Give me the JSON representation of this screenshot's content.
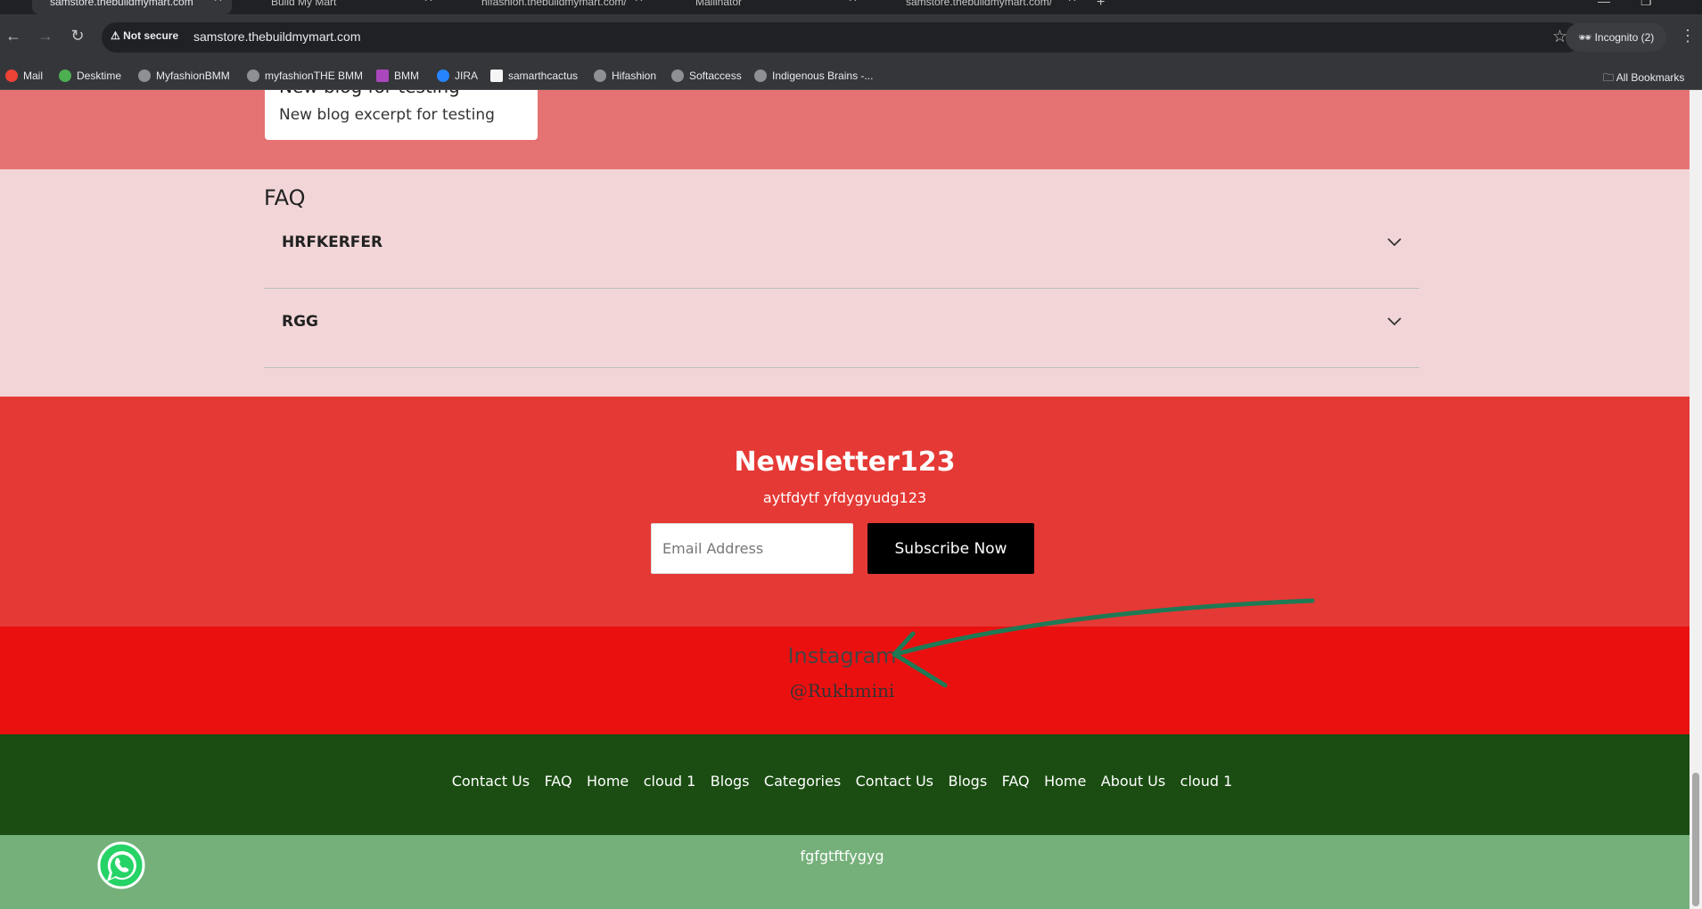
{
  "browser": {
    "tabs": [
      {
        "label": "samstore.thebuildmymart.com",
        "active": true
      },
      {
        "label": "Build My Mart",
        "active": false
      },
      {
        "label": "hifashion.thebuildmymart.com/",
        "active": false
      },
      {
        "label": "Mailinator",
        "active": false
      },
      {
        "label": "samstore.thebuildmymart.com/",
        "active": false
      }
    ],
    "security_label": "Not secure",
    "url": "samstore.thebuildmymart.com",
    "incognito_label": "Incognito (2)",
    "bookmarks": [
      "Mail",
      "Desktime",
      "MyfashionBMM",
      "myfashionTHE BMM",
      "BMM",
      "JIRA",
      "samarthcactus",
      "Hifashion",
      "Softaccess",
      "Indigenous Brains -..."
    ],
    "all_bookmarks_label": "All Bookmarks"
  },
  "blog": {
    "title": "New blog for testing",
    "excerpt": "New blog excerpt for testing"
  },
  "faq": {
    "heading": "FAQ",
    "items": [
      {
        "question": "HRFKERFER"
      },
      {
        "question": "RGG"
      }
    ]
  },
  "newsletter": {
    "title": "Newsletter123",
    "subtitle": "aytfdytf yfdygyudg123",
    "email_placeholder": "Email Address",
    "button_label": "Subscribe Now"
  },
  "instagram": {
    "title": "Instagram",
    "handle": "@Rukhmini"
  },
  "footer": {
    "links": [
      "Contact Us",
      "FAQ",
      "Home",
      "cloud 1",
      "Blogs",
      "Categories",
      "Contact Us",
      "Blogs",
      "FAQ",
      "Home",
      "About Us",
      "cloud 1"
    ],
    "copyright": "fgfgtftfygyg"
  },
  "colors": {
    "blog_band": "#e57373",
    "faq_band": "#f2d6d7",
    "newsletter_band": "#e53935",
    "instagram_band": "#eb1010",
    "footer_band": "#1b4d12",
    "copyright_band": "#75b07a",
    "annotation_arrow": "#1e7a55"
  },
  "icons": {
    "whatsapp": "whatsapp-icon",
    "faq_toggle": "chevron-down-icon"
  }
}
